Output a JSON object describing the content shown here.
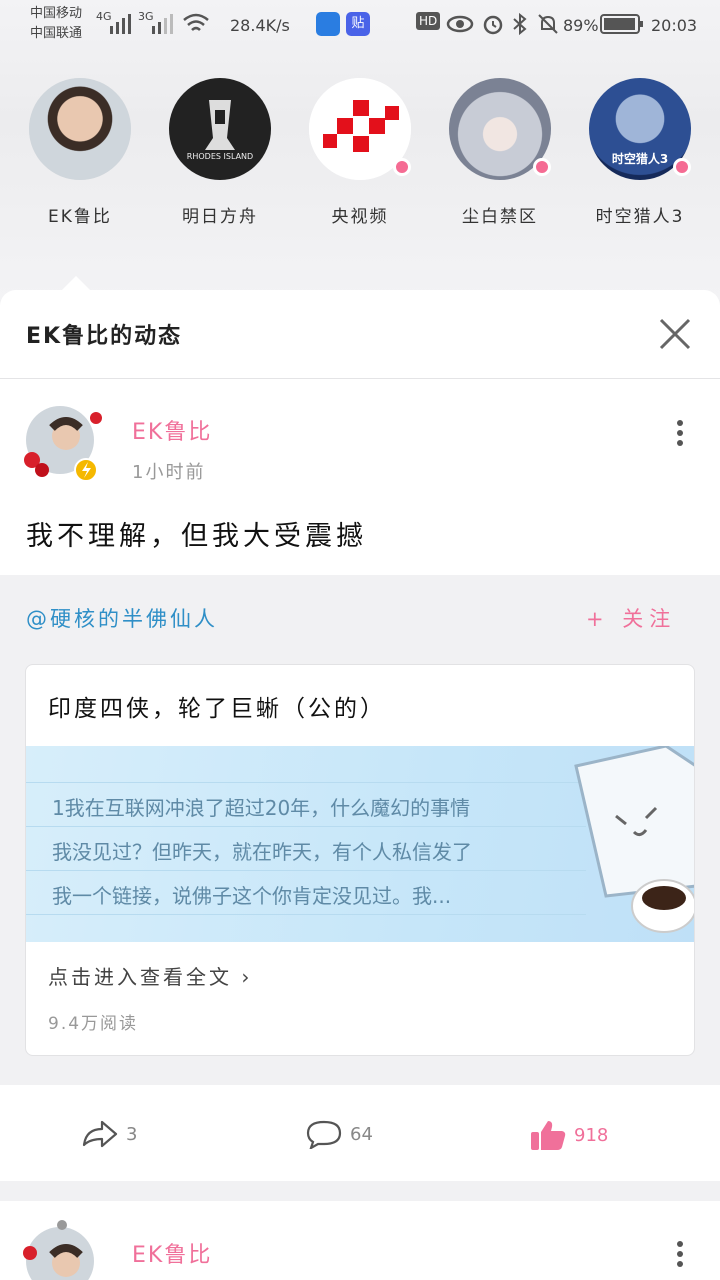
{
  "status_bar": {
    "carrier1": "中国移动",
    "carrier2": "中国联通",
    "net1": "4G",
    "net2": "3G",
    "speed": "28.4K/s",
    "hd": "HD",
    "battery": "89%",
    "time": "20:03"
  },
  "following": [
    {
      "name": "EK鲁比",
      "live": false
    },
    {
      "name": "明日方舟",
      "live": false,
      "avatar_text": "RHODES ISLAND"
    },
    {
      "name": "央视频",
      "live": true
    },
    {
      "name": "尘白禁区",
      "live": true
    },
    {
      "name": "时空猎人3",
      "live": true,
      "avatar_text": "时空猎人3"
    }
  ],
  "sheet": {
    "title": "EK鲁比的动态"
  },
  "post": {
    "author": "EK鲁比",
    "time": "1小时前",
    "text": "我不理解，但我大受震撼",
    "mention": "@硬核的半佛仙人",
    "follow_label": "+ 关注",
    "card": {
      "title": "印度四侠，轮了巨蜥（公的）",
      "banner_lines": [
        "1我在互联网冲浪了超过20年，什么魔幻的事情",
        "我没见过？但昨天，就在昨天，有个人私信发了",
        "我一个链接，说佛子这个你肯定没见过。我..."
      ],
      "link": "点击进入查看全文 ›",
      "reads": "9.4万阅读"
    },
    "actions": {
      "share": "3",
      "comment": "64",
      "like": "918"
    }
  },
  "post2": {
    "author": "EK鲁比"
  },
  "colors": {
    "accent_pink": "#f0709a",
    "link_blue": "#2f8fc7"
  }
}
